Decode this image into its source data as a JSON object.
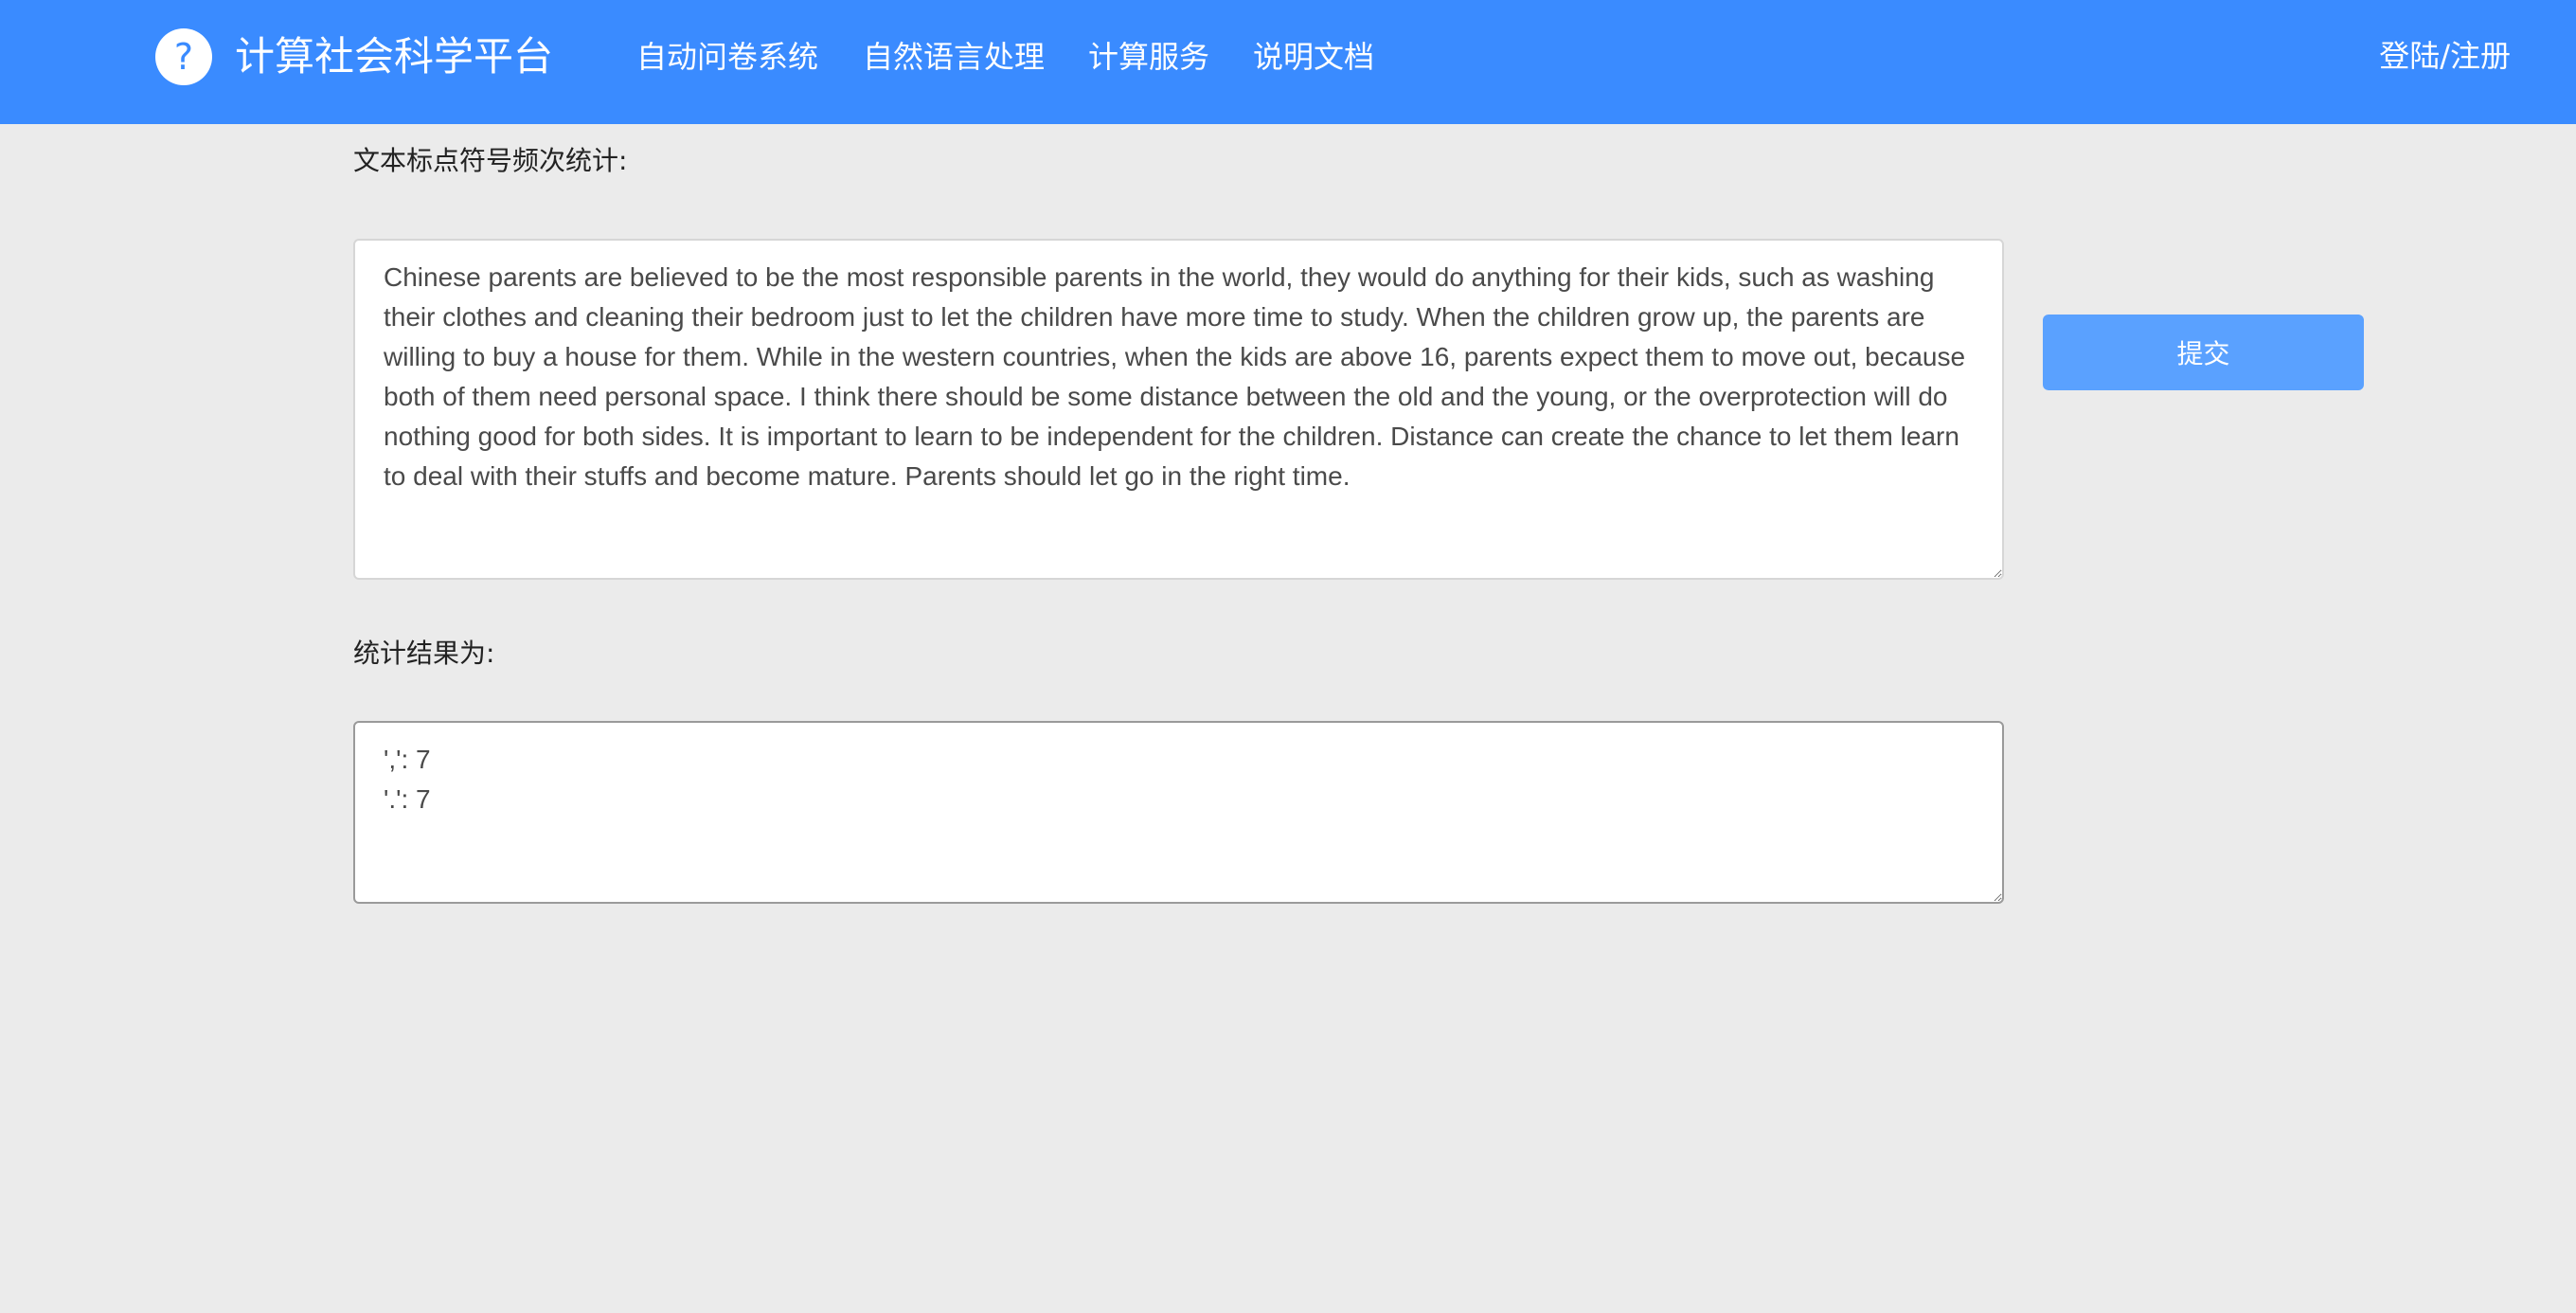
{
  "header": {
    "brand": "计算社会科学平台",
    "logo_icon": "question-mark-icon",
    "logo_glyph": "?",
    "nav": [
      "自动问卷系统",
      "自然语言处理",
      "计算服务",
      "说明文档"
    ],
    "login": "登陆/注册",
    "color": "#3a8bff"
  },
  "main": {
    "input_label": "文本标点符号频次统计:",
    "input_text": "Chinese parents are believed to be the most responsible parents in the world, they would do anything for their kids, such as washing their clothes and cleaning their bedroom just to let the children have more time to study. When the children grow up, the parents are willing to buy a house for them. While in the western countries, when the kids are above 16, parents expect them to move out, because both of them need personal space. I think there should be some distance between the old and the young, or the overprotection will do nothing good for both sides. It is important to learn to be independent for the children. Distance can create the chance to let them learn to deal with their stuffs and become mature. Parents should let go in the right time.",
    "submit_label": "提交",
    "submit_color": "#5aa1ff",
    "result_label": "统计结果为:",
    "result_text": "',': 7\n'.': 7"
  }
}
